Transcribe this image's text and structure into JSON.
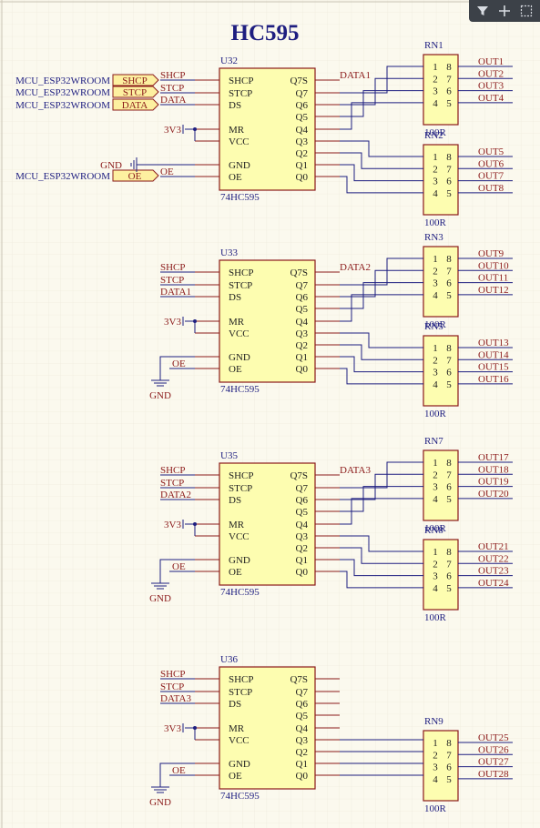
{
  "title": "HC595",
  "toolbar": {
    "filter_icon": "filter-icon",
    "add_icon": "plus-icon",
    "select_icon": "select-rect-icon"
  },
  "colors": {
    "wire": "#1e1e80",
    "part_fill": "#fdfdb0",
    "part_stroke": "#8b1a1a",
    "net_label": "#8b1a1a",
    "designator": "#1e1e80",
    "port_fill": "#fdf0a0",
    "grid": "#e6e2d4",
    "bg": "#fbf9ee"
  },
  "ports": [
    {
      "source": "MCU_ESP32WROOM",
      "name": "SHCP"
    },
    {
      "source": "MCU_ESP32WROOM",
      "name": "STCP"
    },
    {
      "source": "MCU_ESP32WROOM",
      "name": "DATA"
    },
    {
      "source": "MCU_ESP32WROOM",
      "name": "OE"
    }
  ],
  "chip_pins_left": [
    "SHCP",
    "STCP",
    "DS",
    "MR",
    "VCC",
    "GND",
    "OE"
  ],
  "chip_pins_right": [
    "Q7S",
    "Q7",
    "Q6",
    "Q5",
    "Q4",
    "Q3",
    "Q2",
    "Q1",
    "Q0"
  ],
  "power": {
    "v3": "3V3",
    "gnd": "GND",
    "oe": "OE"
  },
  "chips": [
    {
      "designator": "U32",
      "part": "74HC595",
      "in_labels": [
        "SHCP",
        "STCP",
        "DATA"
      ],
      "q7s_net": "DATA1",
      "ground_style": "label"
    },
    {
      "designator": "U33",
      "part": "74HC595",
      "in_labels": [
        "SHCP",
        "STCP",
        "DATA1"
      ],
      "q7s_net": "DATA2",
      "ground_style": "symbol"
    },
    {
      "designator": "U35",
      "part": "74HC595",
      "in_labels": [
        "SHCP",
        "STCP",
        "DATA2"
      ],
      "q7s_net": "DATA3",
      "ground_style": "symbol"
    },
    {
      "designator": "U36",
      "part": "74HC595",
      "in_labels": [
        "SHCP",
        "STCP",
        "DATA3"
      ],
      "q7s_net": "",
      "ground_style": "symbol"
    }
  ],
  "resistor_networks": [
    {
      "designator": "RN1",
      "value": "100R",
      "pins_left": [
        "1",
        "2",
        "3",
        "4"
      ],
      "pins_right": [
        "8",
        "7",
        "6",
        "5"
      ],
      "outputs": [
        "OUT1",
        "OUT2",
        "OUT3",
        "OUT4"
      ]
    },
    {
      "designator": "RN2",
      "value": "100R",
      "pins_left": [
        "1",
        "2",
        "3",
        "4"
      ],
      "pins_right": [
        "8",
        "7",
        "6",
        "5"
      ],
      "outputs": [
        "OUT5",
        "OUT6",
        "OUT7",
        "OUT8"
      ]
    },
    {
      "designator": "RN3",
      "value": "100R",
      "pins_left": [
        "1",
        "2",
        "3",
        "4"
      ],
      "pins_right": [
        "8",
        "7",
        "6",
        "5"
      ],
      "outputs": [
        "OUT9",
        "OUT10",
        "OUT11",
        "OUT12"
      ]
    },
    {
      "designator": "RN5",
      "value": "100R",
      "pins_left": [
        "1",
        "2",
        "3",
        "4"
      ],
      "pins_right": [
        "8",
        "7",
        "6",
        "5"
      ],
      "outputs": [
        "OUT13",
        "OUT14",
        "OUT15",
        "OUT16"
      ]
    },
    {
      "designator": "RN7",
      "value": "100R",
      "pins_left": [
        "1",
        "2",
        "3",
        "4"
      ],
      "pins_right": [
        "8",
        "7",
        "6",
        "5"
      ],
      "outputs": [
        "OUT17",
        "OUT18",
        "OUT19",
        "OUT20"
      ]
    },
    {
      "designator": "RN8",
      "value": "100R",
      "pins_left": [
        "1",
        "2",
        "3",
        "4"
      ],
      "pins_right": [
        "8",
        "7",
        "6",
        "5"
      ],
      "outputs": [
        "OUT21",
        "OUT22",
        "OUT23",
        "OUT24"
      ]
    },
    {
      "designator": "RN9",
      "value": "100R",
      "pins_left": [
        "1",
        "2",
        "3",
        "4"
      ],
      "pins_right": [
        "8",
        "7",
        "6",
        "5"
      ],
      "outputs": [
        "OUT25",
        "OUT26",
        "OUT27",
        "OUT28"
      ]
    }
  ]
}
